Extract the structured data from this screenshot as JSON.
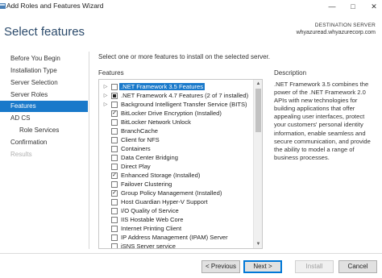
{
  "window": {
    "title": "Add Roles and Features Wizard",
    "controls": [
      "—",
      "□",
      "✕"
    ]
  },
  "header": {
    "page_title": "Select features",
    "destination_label": "DESTINATION SERVER",
    "destination_value": "whyazuread.whyazurecorp.com"
  },
  "sidebar": {
    "items": [
      {
        "label": "Before You Begin",
        "state": "normal"
      },
      {
        "label": "Installation Type",
        "state": "normal"
      },
      {
        "label": "Server Selection",
        "state": "normal"
      },
      {
        "label": "Server Roles",
        "state": "normal"
      },
      {
        "label": "Features",
        "state": "active"
      },
      {
        "label": "AD CS",
        "state": "normal"
      },
      {
        "label": "Role Services",
        "state": "sub"
      },
      {
        "label": "Confirmation",
        "state": "normal"
      },
      {
        "label": "Results",
        "state": "disabled"
      }
    ]
  },
  "main": {
    "intro": "Select one or more features to install on the selected server.",
    "features_label": "Features",
    "description_label": "Description",
    "description_text": ".NET Framework 3.5 combines the power of the .NET Framework 2.0 APIs with new technologies for building applications that offer appealing user interfaces, protect your customers' personal identity information, enable seamless and secure communication, and provide the ability to model a range of business processes.",
    "features": [
      {
        "label": ".NET Framework 3.5 Features",
        "expandable": true,
        "check": "none",
        "selected": true
      },
      {
        "label": ".NET Framework 4.7 Features (2 of 7 installed)",
        "expandable": true,
        "check": "partial",
        "selected": false
      },
      {
        "label": "Background Intelligent Transfer Service (BITS)",
        "expandable": true,
        "check": "none",
        "selected": false
      },
      {
        "label": "BitLocker Drive Encryption (Installed)",
        "expandable": false,
        "check": "checked",
        "selected": false
      },
      {
        "label": "BitLocker Network Unlock",
        "expandable": false,
        "check": "none",
        "selected": false
      },
      {
        "label": "BranchCache",
        "expandable": false,
        "check": "none",
        "selected": false
      },
      {
        "label": "Client for NFS",
        "expandable": false,
        "check": "none",
        "selected": false
      },
      {
        "label": "Containers",
        "expandable": false,
        "check": "none",
        "selected": false
      },
      {
        "label": "Data Center Bridging",
        "expandable": false,
        "check": "none",
        "selected": false
      },
      {
        "label": "Direct Play",
        "expandable": false,
        "check": "none",
        "selected": false
      },
      {
        "label": "Enhanced Storage (Installed)",
        "expandable": false,
        "check": "checked",
        "selected": false
      },
      {
        "label": "Failover Clustering",
        "expandable": false,
        "check": "none",
        "selected": false
      },
      {
        "label": "Group Policy Management (Installed)",
        "expandable": false,
        "check": "checked",
        "selected": false
      },
      {
        "label": "Host Guardian Hyper-V Support",
        "expandable": false,
        "check": "none",
        "selected": false
      },
      {
        "label": "I/O Quality of Service",
        "expandable": false,
        "check": "none",
        "selected": false
      },
      {
        "label": "IIS Hostable Web Core",
        "expandable": false,
        "check": "none",
        "selected": false
      },
      {
        "label": "Internet Printing Client",
        "expandable": false,
        "check": "none",
        "selected": false
      },
      {
        "label": "IP Address Management (IPAM) Server",
        "expandable": false,
        "check": "none",
        "selected": false
      },
      {
        "label": "iSNS Server service",
        "expandable": false,
        "check": "none",
        "selected": false
      }
    ]
  },
  "footer": {
    "previous": "< Previous",
    "next": "Next >",
    "install": "Install",
    "cancel": "Cancel"
  }
}
